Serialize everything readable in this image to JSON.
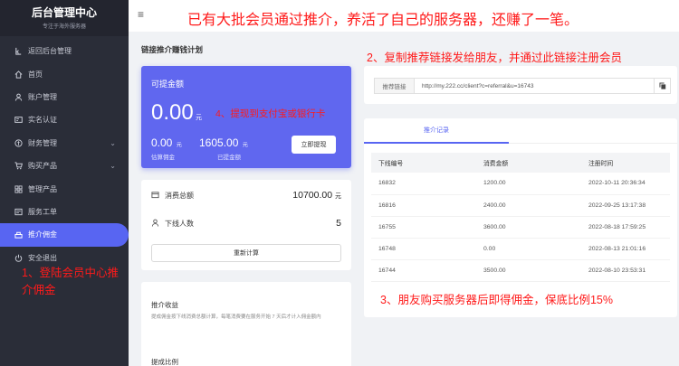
{
  "sidebar": {
    "title": "后台管理中心",
    "subtitle": "专注于海外服务器",
    "items": [
      {
        "label": "返回后台管理",
        "icon": "back-icon"
      },
      {
        "label": "首页",
        "icon": "home-icon"
      },
      {
        "label": "账户管理",
        "icon": "user-icon"
      },
      {
        "label": "实名认证",
        "icon": "id-card-icon"
      },
      {
        "label": "财务管理",
        "icon": "finance-icon"
      },
      {
        "label": "购买产品",
        "icon": "cart-icon"
      },
      {
        "label": "管理产品",
        "icon": "grid-icon"
      },
      {
        "label": "服务工单",
        "icon": "ticket-icon"
      },
      {
        "label": "推介佣金",
        "icon": "share-icon"
      },
      {
        "label": "安全退出",
        "icon": "power-icon"
      }
    ]
  },
  "page": {
    "section_title": "链接推介赚钱计划"
  },
  "balance": {
    "label": "可提金额",
    "amount": "0.00",
    "unit": "元",
    "estimated_value": "0.00",
    "estimated_unit": "元",
    "estimated_label": "估算佣金",
    "withdrawn_value": "1605.00",
    "withdrawn_unit": "元",
    "withdrawn_label": "已提金额",
    "withdraw_button": "立即提现"
  },
  "stats": {
    "consume_label": "消费总额",
    "consume_value": "10700.00",
    "consume_unit": "元",
    "downline_label": "下线人数",
    "downline_value": "5",
    "recalc_button": "重新计算"
  },
  "info": {
    "title": "推介收益",
    "text": "提成佣金按下线消费总额计算，每笔消费要在服务开始 7 天后才计入佣金额内",
    "title2": "提成比例"
  },
  "link": {
    "label": "推荐链接",
    "value": "http://my.222.cc/client?c=referral&u=16743"
  },
  "records": {
    "tab": "推介记录",
    "headers": [
      "下线编号",
      "消费金额",
      "注册时间"
    ],
    "rows": [
      [
        "16832",
        "1200.00",
        "2022-10-11 20:36:34"
      ],
      [
        "16816",
        "2400.00",
        "2022-09-25 13:17:38"
      ],
      [
        "16755",
        "3600.00",
        "2022-08-18 17:59:25"
      ],
      [
        "16748",
        "0.00",
        "2022-08-13 21:01:16"
      ],
      [
        "16744",
        "3500.00",
        "2022-08-10 23:53:31"
      ]
    ]
  },
  "annotations": {
    "top": "已有大批会员通过推介，养活了自己的服务器，还赚了一笔。",
    "step1": "1、登陆会员中心推介佣金",
    "step2": "2、复制推荐链接发给朋友，并通过此链接注册会员",
    "step3": "3、朋友购买服务器后即得佣金，保底比例15%",
    "step4": "4、提现到支付宝或银行卡"
  },
  "colors": {
    "accent": "#5865f2",
    "annotation": "#ff1a1a",
    "sidebar": "#2a2d38"
  }
}
